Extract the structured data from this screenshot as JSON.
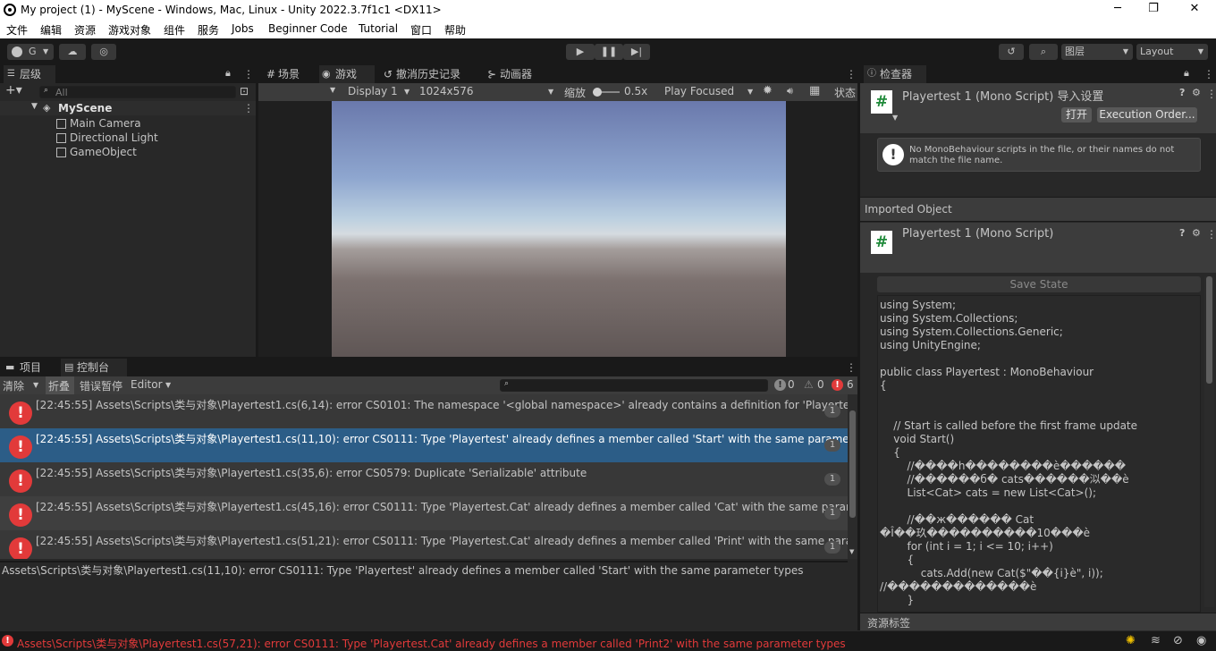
{
  "window": {
    "title": "My project (1) - MyScene - Windows, Mac, Linux - Unity 2022.3.7f1c1 <DX11>",
    "minimize": "─",
    "maximize": "❐",
    "close": "✕"
  },
  "menu": [
    "文件",
    "编辑",
    "资源",
    "游戏对象",
    "组件",
    "服务",
    "Jobs",
    "Beginner Code",
    "Tutorial",
    "窗口",
    "帮助"
  ],
  "toolbar": {
    "account": "G",
    "layers": "图层",
    "layout": "Layout"
  },
  "hierarchy": {
    "tab": "层级",
    "search_placeholder": "All",
    "scene": "MyScene",
    "items": [
      "Main Camera",
      "Directional Light",
      "GameObject"
    ]
  },
  "game_tabs": [
    "场景",
    "游戏",
    "撤消历史记录",
    "动画器"
  ],
  "game_toolbar": {
    "display": "Display 1",
    "resolution": "1024x576",
    "scale_label": "缩放",
    "scale_value": "0.5x",
    "play_mode": "Play Focused",
    "stats": "状态"
  },
  "bottom_tabs": [
    "项目",
    "控制台"
  ],
  "console": {
    "clear": "清除",
    "collapse": "折叠",
    "error_pause": "错误暂停",
    "editor": "Editor",
    "info_count": "0",
    "warn_count": "0",
    "error_count": "6",
    "logs": [
      {
        "text": "[22:45:55] Assets\\Scripts\\类与对象\\Playertest1.cs(6,14): error CS0101: The namespace '<global namespace>' already contains a definition for 'Playertest'",
        "count": "1",
        "selected": false
      },
      {
        "text": "[22:45:55] Assets\\Scripts\\类与对象\\Playertest1.cs(11,10): error CS0111: Type 'Playertest' already defines a member called 'Start' with the same parameter types",
        "count": "1",
        "selected": true
      },
      {
        "text": "[22:45:55] Assets\\Scripts\\类与对象\\Playertest1.cs(35,6): error CS0579: Duplicate 'Serializable' attribute",
        "count": "1",
        "selected": false
      },
      {
        "text": "[22:45:55] Assets\\Scripts\\类与对象\\Playertest1.cs(45,16): error CS0111: Type 'Playertest.Cat' already defines a member called 'Cat' with the same parameter types",
        "count": "1",
        "selected": false
      },
      {
        "text": "[22:45:55] Assets\\Scripts\\类与对象\\Playertest1.cs(51,21): error CS0111: Type 'Playertest.Cat' already defines a member called 'Print' with the same parameter types",
        "count": "1",
        "selected": false
      }
    ],
    "detail": "Assets\\Scripts\\类与对象\\Playertest1.cs(11,10): error CS0111: Type 'Playertest' already defines a member called 'Start' with the same parameter types"
  },
  "inspector": {
    "tab": "检查器",
    "title": "Playertest 1 (Mono Script) 导入设置",
    "open": "打开",
    "exec_order": "Execution Order...",
    "warning": "No MonoBehaviour scripts in the file, or their names do not match the file name.",
    "imported_object": "Imported Object",
    "script_name": "Playertest 1 (Mono Script)",
    "save_state": "Save State",
    "asset_labels": "资源标签",
    "code": "using System;\nusing System.Collections;\nusing System.Collections.Generic;\nusing UnityEngine;\n\npublic class Playertest : MonoBehaviour\n{\n\n\n    // Start is called before the first frame update\n    void Start()\n    {\n        //����h��������è������\n        //������б� cats������泤��è\n        List<Cat> cats = new List<Cat>();\n\n        //��ж������ Cat\n�Î��玖����������10���è\n        for (int i = 1; i <= 10; i++)\n        {\n            cats.Add(new Cat($\"��{i}è\", i));\n//�������������è\n        }"
  },
  "statusbar": {
    "message": "Assets\\Scripts\\类与对象\\Playertest1.cs(57,21): error CS0111: Type 'Playertest.Cat' already defines a member called 'Print2' with the same parameter types"
  },
  "colors": {
    "error": "#e23a3a",
    "selection": "#2c5d87",
    "panel": "#282828",
    "dark": "#191919"
  }
}
